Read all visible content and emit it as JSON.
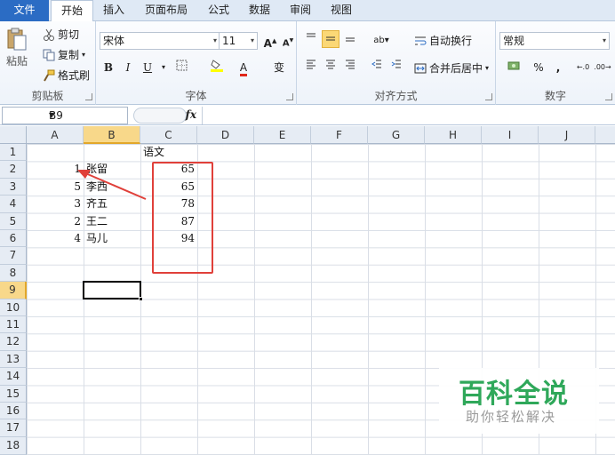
{
  "tabs": [
    "文件",
    "开始",
    "插入",
    "页面布局",
    "公式",
    "数据",
    "审阅",
    "视图"
  ],
  "ribbon": {
    "clipboard": {
      "paste": "粘贴",
      "cut": "剪切",
      "copy": "复制",
      "format_painter": "格式刷",
      "label": "剪贴板"
    },
    "font": {
      "family": "宋体",
      "size": "11",
      "grow": "A",
      "shrink": "A",
      "bold": "B",
      "italic": "I",
      "underline": "U",
      "phonetic": "变",
      "label": "字体"
    },
    "alignment": {
      "wrap": "自动换行",
      "merge": "合并后居中",
      "label": "对齐方式"
    },
    "number": {
      "format": "常规",
      "percent": "%",
      "comma": ",",
      "label": "数字"
    }
  },
  "formula_bar": {
    "name_box": "B9",
    "fx": "fx",
    "content": ""
  },
  "columns": [
    "A",
    "B",
    "C",
    "D",
    "E",
    "F",
    "G",
    "H",
    "I",
    "J"
  ],
  "rows": [
    "1",
    "2",
    "3",
    "4",
    "5",
    "6",
    "7",
    "8",
    "9",
    "10",
    "11",
    "12",
    "13",
    "14",
    "15",
    "16",
    "17",
    "18"
  ],
  "selected": {
    "column": "B",
    "row": "9"
  },
  "sheet": {
    "header_c1": "语文",
    "data": [
      {
        "a": "1",
        "b": "张留",
        "c": "65"
      },
      {
        "a": "5",
        "b": "李西",
        "c": "65"
      },
      {
        "a": "3",
        "b": "齐五",
        "c": "78"
      },
      {
        "a": "2",
        "b": "王二",
        "c": "87"
      },
      {
        "a": "4",
        "b": "马儿",
        "c": "94"
      }
    ]
  },
  "annotation_color": "#e0403a",
  "watermark": {
    "main": "百科全说",
    "sub": "助你轻松解决"
  }
}
